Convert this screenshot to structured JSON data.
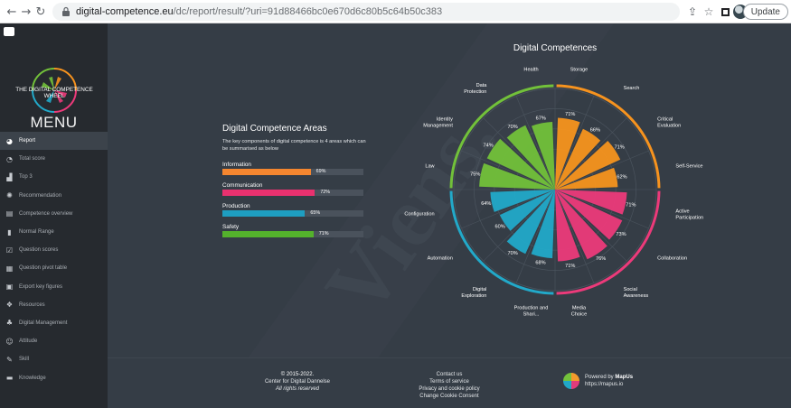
{
  "browser": {
    "url_host": "digital-competence.eu",
    "url_path": "/dc/report/result/?uri=91d88466bc0e670d6c80b5c64b50c383",
    "update_label": "Update"
  },
  "sidebar": {
    "logo_text_line1": "THE DIGITAL COMPETENCE",
    "logo_text_line2": "WHEEL",
    "menu_title": "MENU",
    "items": [
      {
        "label": "Report",
        "icon": "report-icon",
        "active": true
      },
      {
        "label": "Total score",
        "icon": "gauge-icon"
      },
      {
        "label": "Top 3",
        "icon": "podium-icon"
      },
      {
        "label": "Recommendation",
        "icon": "compass-icon"
      },
      {
        "label": "Competence overview",
        "icon": "chart-icon"
      },
      {
        "label": "Normal Range",
        "icon": "thermometer-icon"
      },
      {
        "label": "Question scores",
        "icon": "check-icon"
      },
      {
        "label": "Question pivot table",
        "icon": "table-icon"
      },
      {
        "label": "Export key figures",
        "icon": "file-icon"
      },
      {
        "label": "Resources",
        "icon": "cubes-icon"
      },
      {
        "label": "Digital Management",
        "icon": "tree-icon"
      },
      {
        "label": "Attitude",
        "icon": "people-icon"
      },
      {
        "label": "Skill",
        "icon": "wrench-icon"
      },
      {
        "label": "Knowledge",
        "icon": "book-icon"
      }
    ]
  },
  "areas": {
    "title": "Digital Competence Areas",
    "description": "The key components of digital competence is 4 areas which can be summarised as below",
    "items": [
      {
        "label": "Information",
        "value": 69,
        "pct": "69%",
        "color": "#f5862f"
      },
      {
        "label": "Communication",
        "value": 72,
        "pct": "72%",
        "color": "#e9316f"
      },
      {
        "label": "Production",
        "value": 65,
        "pct": "65%",
        "color": "#1e9ec1"
      },
      {
        "label": "Safety",
        "value": 71,
        "pct": "71%",
        "color": "#54b22c"
      }
    ]
  },
  "chart_data": {
    "type": "polar-bar",
    "title": "Digital Competences",
    "r_max": 100,
    "categories": [
      "Storage",
      "Search",
      "Critical Evaluation",
      "Self-Service",
      "Active Participation",
      "Collaboration",
      "Social Awareness",
      "Media Choice",
      "Production and Shari...",
      "Digital Exploration",
      "Automation",
      "Configuration",
      "Law",
      "Identity Management",
      "Data Protection",
      "Health"
    ],
    "area_of_category": [
      "Information",
      "Information",
      "Information",
      "Information",
      "Communication",
      "Communication",
      "Communication",
      "Communication",
      "Production",
      "Production",
      "Production",
      "Production",
      "Safety",
      "Safety",
      "Safety",
      "Safety"
    ],
    "spoke_values": [
      [
        71,
        66,
        71,
        62
      ],
      [
        71,
        73,
        76,
        71
      ],
      [
        68,
        70,
        60,
        64
      ],
      [
        75,
        74,
        70,
        67
      ]
    ],
    "spoke_labels": [
      [
        "71%",
        "66%",
        "71%",
        "62%"
      ],
      [
        "71%",
        "73%",
        "76%",
        "71%"
      ],
      [
        "68%",
        "70%",
        "60%",
        "64%"
      ],
      [
        "75%",
        "74%",
        "70%",
        "67%"
      ]
    ],
    "area_colors": {
      "Information": "#f7931e",
      "Communication": "#ec3a7a",
      "Production": "#22a9c9",
      "Safety": "#72c13a"
    },
    "grid": true
  },
  "footer": {
    "copyright": "© 2015-2022.",
    "org": "Center for Digital Dannelse",
    "rights": "All rights reserved",
    "contact": "Contact us",
    "terms": "Terms of service",
    "privacy": "Privacy and cookie policy",
    "cookie": "Change Cookie Consent",
    "powered_prefix": "Powered by",
    "powered_brand": "MapUs",
    "powered_url": "https://mapus.io"
  }
}
